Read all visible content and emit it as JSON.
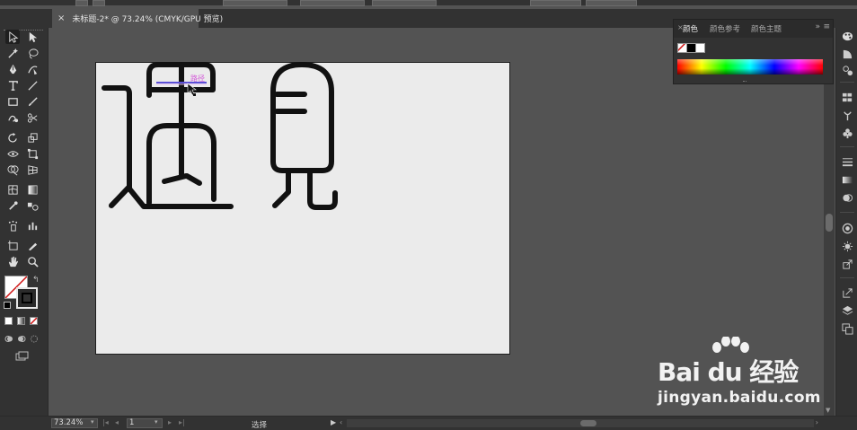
{
  "app": {
    "document_tab": {
      "title": "未标题-2* @ 73.24% (CMYK/GPU 预览)",
      "close_label": "×"
    }
  },
  "artboard": {
    "cursor_label": "路径"
  },
  "color_panel": {
    "close_label": "×",
    "tabs": [
      {
        "label": "颜色",
        "active": true
      },
      {
        "label": "颜色参考",
        "active": false
      },
      {
        "label": "颜色主题",
        "active": false
      }
    ],
    "more_label": "»",
    "menu_label": "≡"
  },
  "status_bar": {
    "zoom": "73.24%",
    "page": "1",
    "status_text": "选择"
  },
  "watermark": {
    "brand": "Bai du 经验",
    "url": "jingyan.baidu.com"
  },
  "colors": {
    "chrome_dark": "#323232",
    "canvas_bg": "#535353",
    "artboard_bg": "#ebebeb",
    "stroke_art": "#111111",
    "selection_path": "#5b4fd6",
    "label_magenta": "#d35ad8"
  },
  "icons": {
    "toolbar": [
      "selection-tool-icon",
      "direct-selection-tool-icon",
      "magic-wand-icon",
      "lasso-icon",
      "pen-tool-icon",
      "curvature-tool-icon",
      "type-tool-icon",
      "line-tool-icon",
      "rectangle-tool-icon",
      "paintbrush-icon",
      "shaper-tool-icon",
      "scissors-icon",
      "rotate-tool-icon",
      "scale-tool-icon",
      "width-tool-icon",
      "free-transform-icon",
      "shape-builder-icon",
      "perspective-grid-icon",
      "mesh-tool-icon",
      "gradient-tool-icon",
      "eyedropper-icon",
      "blend-tool-icon",
      "symbol-sprayer-icon",
      "column-graph-icon",
      "artboard-tool-icon",
      "slice-tool-icon",
      "hand-tool-icon",
      "zoom-tool-icon"
    ],
    "dock": [
      "color-panel-icon",
      "color-guide-icon",
      "color-themes-icon",
      "swatches-icon",
      "brushes-icon",
      "symbols-icon",
      "stroke-icon",
      "gradient-icon",
      "transparency-icon",
      "appearance-icon",
      "graphic-styles-icon",
      "export-icon",
      "layers-icon",
      "artboards-icon"
    ]
  }
}
